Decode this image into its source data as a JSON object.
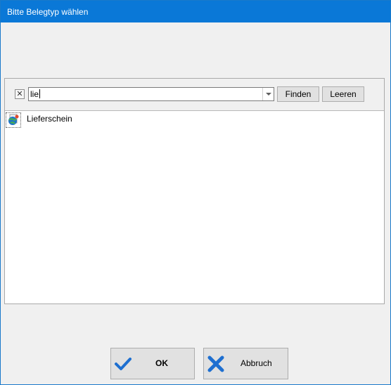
{
  "window": {
    "title": "Bitte Belegtyp wählen"
  },
  "filter": {
    "clear_glyph": "✕",
    "search_value": "lie",
    "find_label": "Finden",
    "clear_label": "Leeren"
  },
  "list": {
    "items": [
      {
        "label": "Lieferschein",
        "icon": "globe-document-icon"
      }
    ]
  },
  "buttons": {
    "ok_label": "OK",
    "ok_icon": "checkmark-icon",
    "cancel_label": "Abbruch",
    "cancel_icon": "cross-icon"
  },
  "colors": {
    "titlebar": "#0a78d7",
    "accent_icon": "#1e6fd0"
  }
}
